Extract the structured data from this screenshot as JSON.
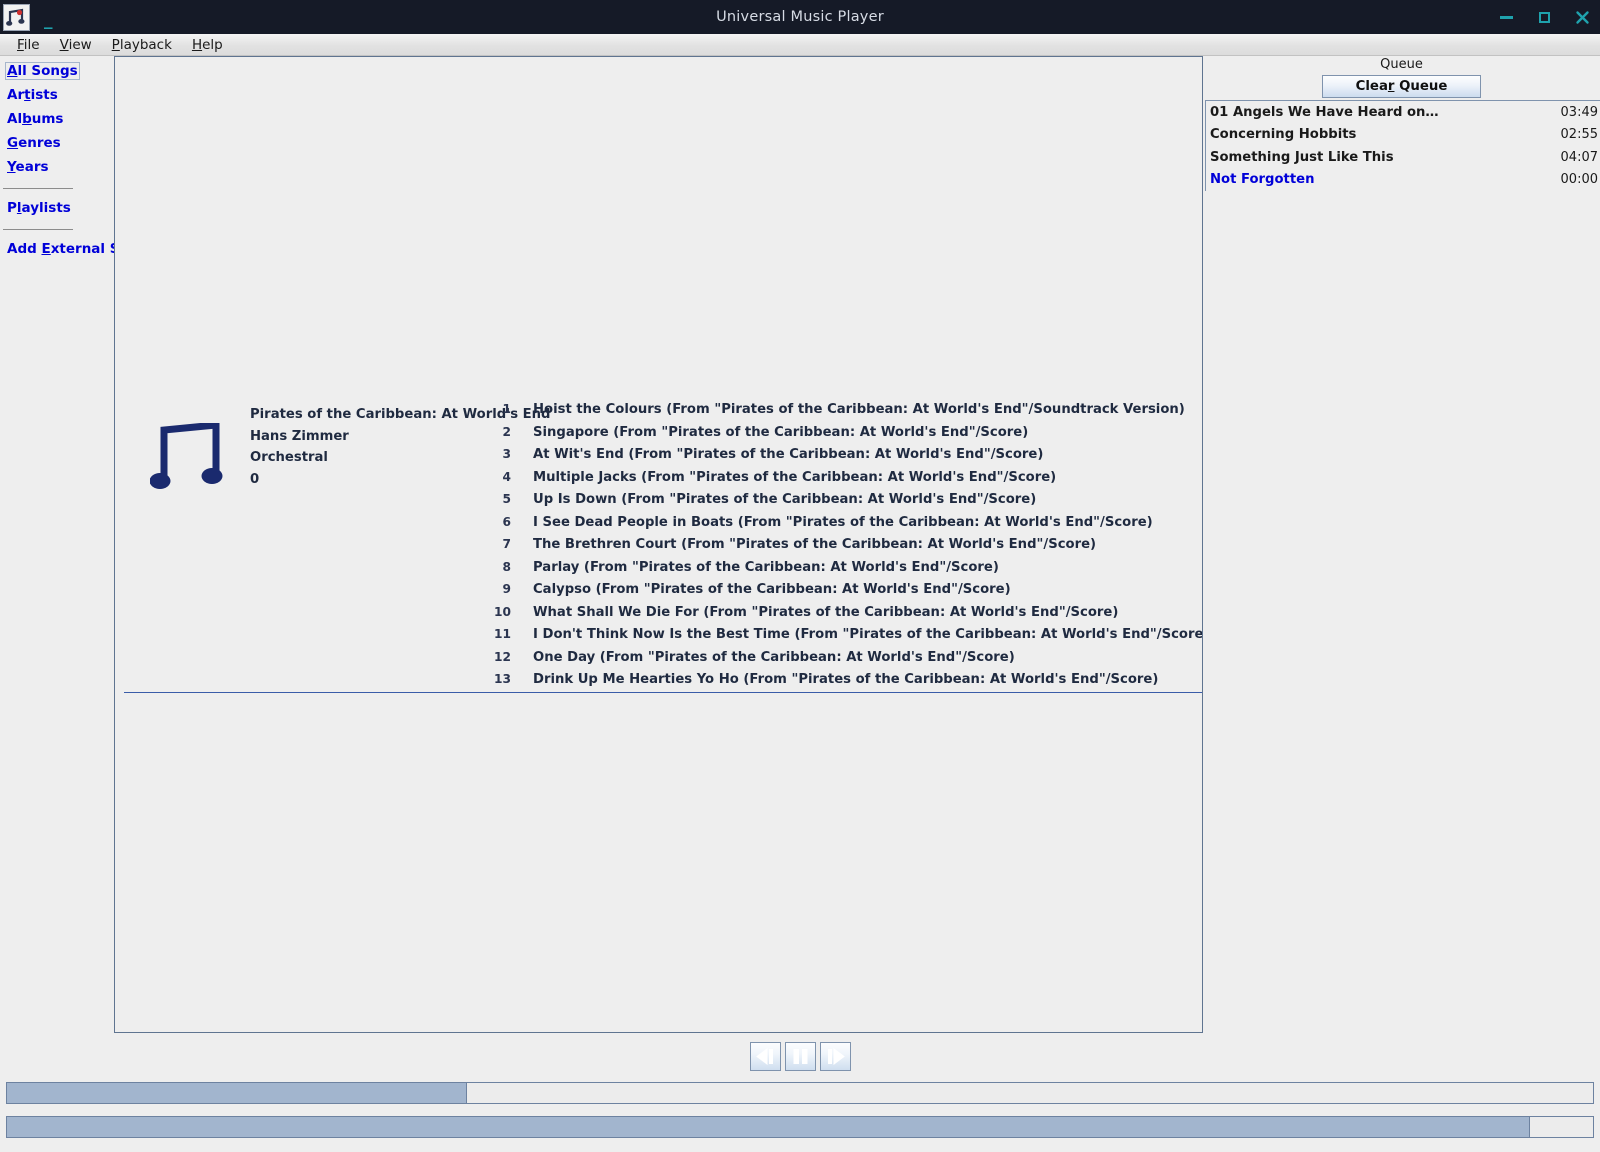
{
  "window": {
    "title": "Universal Music Player",
    "icon": "music-player-app-icon",
    "controls": {
      "minimize": "minimize-icon",
      "maximize": "maximize-icon",
      "close": "close-icon"
    },
    "accent_teal": "#1fa2ad",
    "titlebar_bg": "#151a27"
  },
  "menubar": {
    "items": [
      {
        "label": "File",
        "mnemonic": "F"
      },
      {
        "label": "View",
        "mnemonic": "V"
      },
      {
        "label": "Playback",
        "mnemonic": "P"
      },
      {
        "label": "Help",
        "mnemonic": "H"
      }
    ]
  },
  "sidebar": {
    "link_color": "#0000d8",
    "items": [
      {
        "label": "All Songs",
        "mnemonic": "A",
        "focused": true
      },
      {
        "label": "Artists",
        "mnemonic": "t",
        "focused": false
      },
      {
        "label": "Albums",
        "mnemonic": "b",
        "focused": false
      },
      {
        "label": "Genres",
        "mnemonic": "G",
        "focused": false
      },
      {
        "label": "Years",
        "mnemonic": "Y",
        "focused": false
      },
      {
        "label": "Playlists",
        "mnemonic": "l",
        "focused": false
      },
      {
        "label": "Add External Song",
        "mnemonic": "E",
        "focused": false
      }
    ]
  },
  "album": {
    "art_icon": "music-note-icon",
    "title": "Pirates of the Caribbean: At World's End",
    "artist": "Hans Zimmer",
    "genre": "Orchestral",
    "year": "0",
    "tracks": [
      {
        "num": "1",
        "title": "Hoist the Colours (From \"Pirates of the Caribbean: At World's End\"/Soundtrack Version)"
      },
      {
        "num": "2",
        "title": "Singapore (From \"Pirates of the Caribbean: At World's End\"/Score)"
      },
      {
        "num": "3",
        "title": "At Wit's End (From \"Pirates of the Caribbean: At World's End\"/Score)"
      },
      {
        "num": "4",
        "title": "Multiple Jacks (From \"Pirates of the Caribbean: At World's End\"/Score)"
      },
      {
        "num": "5",
        "title": "Up Is Down (From \"Pirates of the Caribbean: At World's End\"/Score)"
      },
      {
        "num": "6",
        "title": "I See Dead People in Boats (From \"Pirates of the Caribbean: At World's End\"/Score)"
      },
      {
        "num": "7",
        "title": "The Brethren Court (From \"Pirates of the Caribbean: At World's End\"/Score)"
      },
      {
        "num": "8",
        "title": "Parlay (From \"Pirates of the Caribbean: At World's End\"/Score)"
      },
      {
        "num": "9",
        "title": "Calypso (From \"Pirates of the Caribbean: At World's End\"/Score)"
      },
      {
        "num": "10",
        "title": "What Shall We Die For (From \"Pirates of the Caribbean: At World's End\"/Score)"
      },
      {
        "num": "11",
        "title": "I Don't Think Now Is the Best Time (From \"Pirates of the Caribbean: At World's End\"/Score)"
      },
      {
        "num": "12",
        "title": "One Day (From \"Pirates of the Caribbean: At World's End\"/Score)"
      },
      {
        "num": "13",
        "title": "Drink Up Me Hearties Yo Ho (From \"Pirates of the Caribbean: At World's End\"/Score)"
      }
    ]
  },
  "queue": {
    "heading": "Queue",
    "clear_label": "Clear Queue",
    "clear_mnemonic": "r",
    "playing_color": "#0000d8",
    "items": [
      {
        "name": "01 Angels We Have Heard on…",
        "time": "03:49",
        "playing": false
      },
      {
        "name": "Concerning Hobbits",
        "time": "02:55",
        "playing": false
      },
      {
        "name": "Something Just Like This",
        "time": "04:07",
        "playing": false
      },
      {
        "name": "Not Forgotten",
        "time": "00:00",
        "playing": true
      }
    ]
  },
  "transport": {
    "previous": "previous-track-icon",
    "pause": "pause-icon",
    "next": "next-track-icon"
  },
  "sliders": {
    "seek_percent": 29,
    "volume_percent": 96,
    "fill_color": "#a2b5ce"
  }
}
